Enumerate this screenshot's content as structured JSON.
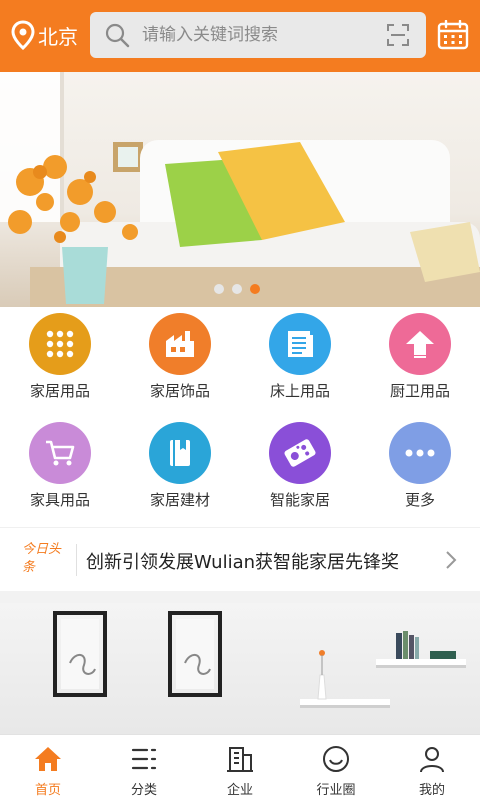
{
  "header": {
    "location": "北京",
    "search_placeholder": "请输入关键词搜索",
    "icons": {
      "location": "location-pin-icon",
      "search": "search-icon",
      "scan": "scan-icon",
      "calendar": "calendar-icon"
    },
    "colors": {
      "brand": "#f47c20"
    }
  },
  "banner": {
    "slide_count": 3,
    "active_slide": 3
  },
  "categories": [
    {
      "label": "家居用品",
      "color": "#e59d1a",
      "icon": "grid-dots-icon"
    },
    {
      "label": "家居饰品",
      "color": "#f07e2a",
      "icon": "factory-icon"
    },
    {
      "label": "床上用品",
      "color": "#33a6e8",
      "icon": "document-icon"
    },
    {
      "label": "厨卫用品",
      "color": "#ee6a97",
      "icon": "house-arrow-icon"
    },
    {
      "label": "家具用品",
      "color": "#c98bd8",
      "icon": "shopping-cart-icon"
    },
    {
      "label": "家居建材",
      "color": "#2aa5d8",
      "icon": "book-icon"
    },
    {
      "label": "智能家居",
      "color": "#8a4fd8",
      "icon": "circuit-board-icon"
    },
    {
      "label": "更多",
      "color": "#7f9ee5",
      "icon": "more-dots-icon"
    }
  ],
  "headline": {
    "tag": "今日头条",
    "text": "创新引领发展Wulian获智能家居先锋奖"
  },
  "nav": {
    "items": [
      {
        "label": "首页",
        "icon": "home-icon",
        "active": true
      },
      {
        "label": "分类",
        "icon": "category-list-icon",
        "active": false
      },
      {
        "label": "企业",
        "icon": "building-icon",
        "active": false
      },
      {
        "label": "行业圈",
        "icon": "smile-circle-icon",
        "active": false
      },
      {
        "label": "我的",
        "icon": "user-icon",
        "active": false
      }
    ]
  }
}
